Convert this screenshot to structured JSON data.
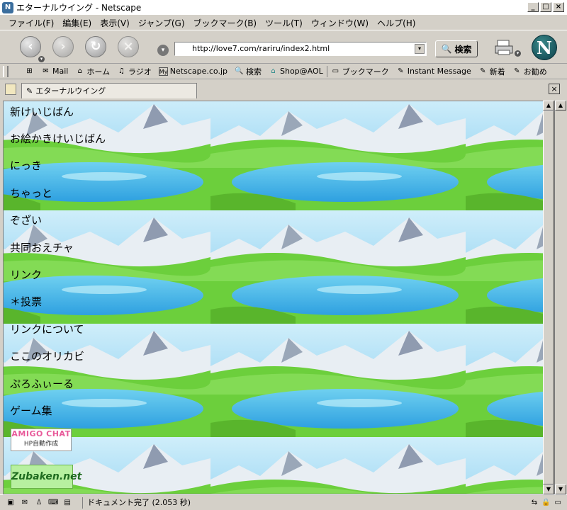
{
  "window": {
    "title": "エターナルウイング - Netscape",
    "app_icon": "N"
  },
  "menubar": {
    "items": [
      "ファイル(F)",
      "編集(E)",
      "表示(V)",
      "ジャンプ(G)",
      "ブックマーク(B)",
      "ツール(T)",
      "ウィンドウ(W)",
      "ヘルプ(H)"
    ]
  },
  "navbar": {
    "url": "http://love7.com/rariru/index2.html",
    "search_label": "検索",
    "logo": "N"
  },
  "personal_toolbar": {
    "items": [
      {
        "label": "Mail",
        "icon": "mail-icon"
      },
      {
        "label": "ホーム",
        "icon": "home-icon"
      },
      {
        "label": "ラジオ",
        "icon": "headphones-icon"
      },
      {
        "label": "Netscape.co.jp",
        "icon": "my-icon"
      },
      {
        "label": "検索",
        "icon": "search-icon"
      },
      {
        "label": "Shop@AOL",
        "icon": "shop-icon"
      },
      {
        "label": "ブックマーク",
        "icon": "folder-icon"
      },
      {
        "label": "Instant Message",
        "icon": "link-icon"
      },
      {
        "label": "新着",
        "icon": "link-icon"
      },
      {
        "label": "お勧め",
        "icon": "link-icon"
      }
    ]
  },
  "tab": {
    "label": "エターナルウイング"
  },
  "page": {
    "links": [
      "新けいじばん",
      "お絵かきけいじばん",
      "にっき",
      "ちゃっと",
      "ぞざい",
      "共同おえチャ",
      "リンク",
      "＊投票",
      "リンクについて",
      "ここのオリカビ",
      "ぷろふぃーる",
      "ゲーム集"
    ],
    "banner_amigo": {
      "title": "AMIGO CHAT",
      "subtitle": "HP自動作成"
    },
    "banner_zubaken": "Zubaken.net"
  },
  "statusbar": {
    "text": "ドキュメント完了 (2.053 秒)"
  }
}
